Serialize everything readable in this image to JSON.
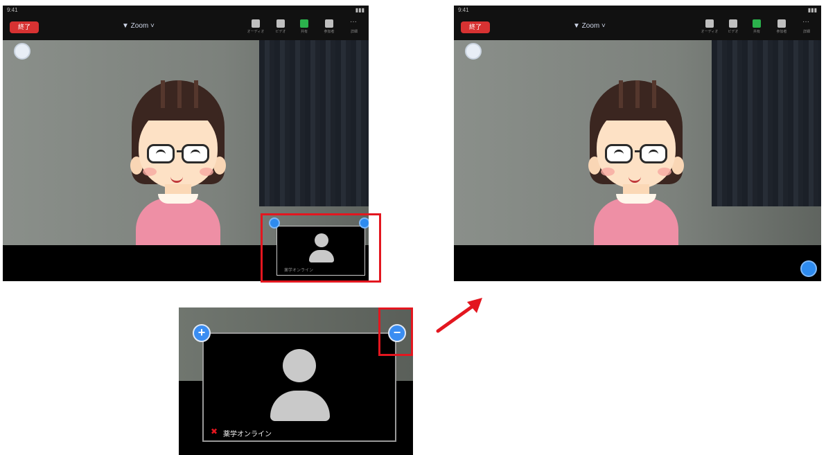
{
  "screens": [
    {
      "status_time": "9:41",
      "end_label": "終了",
      "title": "▼ Zoom ˅",
      "toolbar": [
        {
          "label": "オーディオ",
          "icon": "microphone-icon"
        },
        {
          "label": "ビデオ",
          "icon": "video-camera-icon"
        },
        {
          "label": "共有",
          "icon": "share-screen-icon"
        },
        {
          "label": "参加者",
          "icon": "participants-icon"
        },
        {
          "label": "詳細",
          "icon": "more-icon"
        }
      ]
    },
    {
      "status_time": "9:41",
      "end_label": "終了",
      "title": "▼ Zoom ˅",
      "toolbar": [
        {
          "label": "オーディオ",
          "icon": "microphone-icon"
        },
        {
          "label": "ビデオ",
          "icon": "video-camera-icon"
        },
        {
          "label": "共有",
          "icon": "share-screen-icon"
        },
        {
          "label": "参加者",
          "icon": "participants-icon"
        },
        {
          "label": "詳細",
          "icon": "more-icon"
        }
      ]
    }
  ],
  "pip": {
    "name": "薬学オンライン",
    "small_name": "薬学オンライン",
    "plus": "+",
    "minus": "−"
  },
  "colors": {
    "highlight": "#e3161f",
    "zoom_blue": "#2e8bef",
    "end_red": "#d73232"
  }
}
